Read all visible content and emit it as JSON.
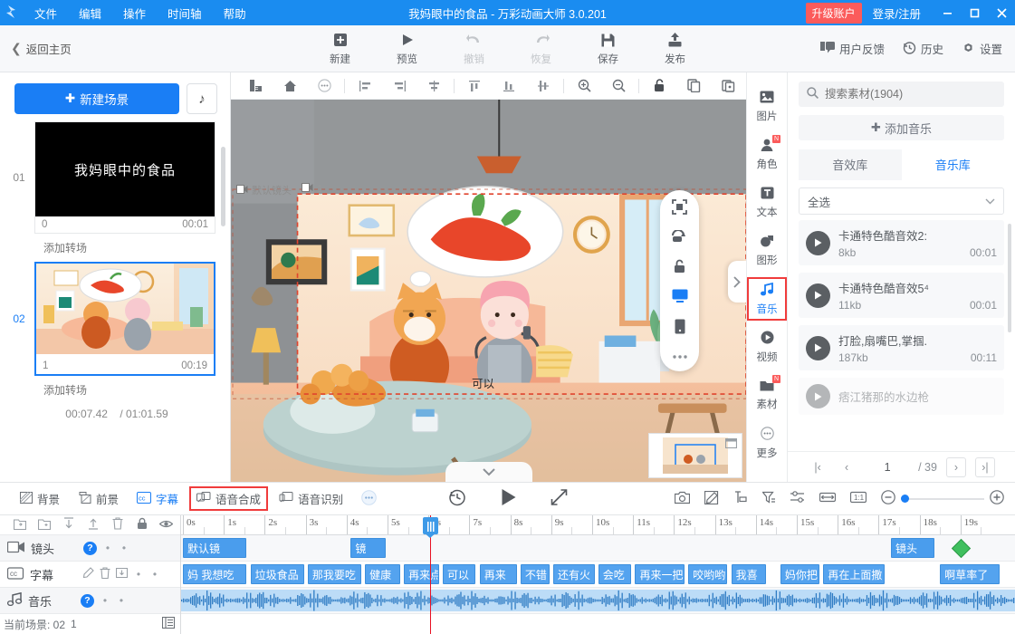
{
  "titlebar": {
    "logo_icon": "app-logo-icon",
    "menus": [
      "文件",
      "编辑",
      "操作",
      "时间轴",
      "帮助"
    ],
    "title": "我妈眼中的食品 - 万彩动画大师 3.0.201",
    "upgrade_label": "升级账户",
    "login_label": "登录/注册",
    "minimize": "—",
    "maximize": "▢",
    "close": "✕",
    "accent": "#1a8cf0",
    "upgrade_color": "#fb5b5b"
  },
  "toolbar": {
    "back_label": "返回主页",
    "buttons": [
      {
        "label": "新建",
        "icon": "plus-square-icon",
        "disabled": false
      },
      {
        "label": "预览",
        "icon": "play-icon",
        "disabled": false
      },
      {
        "label": "撤销",
        "icon": "undo-arrow-icon",
        "disabled": true
      },
      {
        "label": "恢复",
        "icon": "redo-arrow-icon",
        "disabled": true
      },
      {
        "label": "保存",
        "icon": "save-disk-icon",
        "disabled": false
      },
      {
        "label": "发布",
        "icon": "publish-upload-icon",
        "disabled": false
      }
    ],
    "right_items": [
      {
        "label": "用户反馈",
        "icon": "feedback-icon"
      },
      {
        "label": "历史",
        "icon": "history-clock-icon"
      },
      {
        "label": "设置",
        "icon": "gear-icon"
      }
    ]
  },
  "scenes": {
    "new_scene_label": "新建场景",
    "music_btn_icon": "music-note-icon",
    "items": [
      {
        "num": "01",
        "title": "我妈眼中的食品",
        "index": "0",
        "duration": "00:01",
        "selected": false,
        "type": "text"
      },
      {
        "num": "02",
        "title": "",
        "index": "1",
        "duration": "00:19",
        "selected": true,
        "type": "image"
      }
    ],
    "transition_label": "添加转场",
    "current_time": "00:07.42",
    "total_time": "/ 01:01.59"
  },
  "canvas_tools": [
    "ruler-icon",
    "home-icon",
    "more-circle-icon",
    "align-left-icon",
    "align-right-icon",
    "align-center-h-icon",
    "align-top-icon",
    "align-bottom-icon",
    "align-center-v-icon",
    "zoom-in-icon",
    "zoom-out-icon",
    "unlock-icon",
    "copy-icon",
    "paste-icon"
  ],
  "stage": {
    "layer_label": "默认镜头",
    "object_index": "1",
    "speech_text": "可以",
    "float_tools": [
      "select-frame-icon",
      "rotate-icon",
      "unlock-icon",
      "screen-icon",
      "mobile-icon",
      "more-dots-icon"
    ],
    "expand_arrow": "chevron-right-icon",
    "collapse_arrow": "chevron-down-icon",
    "minimap_icon": "minimap-window-icon"
  },
  "rail": [
    {
      "label": "图片",
      "icon": "image-icon",
      "badge": "",
      "selected": false
    },
    {
      "label": "角色",
      "icon": "person-icon",
      "badge": "N",
      "selected": false
    },
    {
      "label": "文本",
      "icon": "text-t-icon",
      "badge": "",
      "selected": false
    },
    {
      "label": "图形",
      "icon": "shapes-icon",
      "badge": "",
      "selected": false
    },
    {
      "label": "音乐",
      "icon": "music-note-icon",
      "badge": "",
      "selected": true
    },
    {
      "label": "视频",
      "icon": "video-play-icon",
      "badge": "",
      "selected": false
    },
    {
      "label": "素材",
      "icon": "folder-icon",
      "badge": "N",
      "selected": false
    },
    {
      "label": "更多",
      "icon": "more-circle-icon",
      "badge": "",
      "selected": false
    }
  ],
  "library": {
    "search_placeholder": "搜索素材(1904)",
    "search_icon": "search-icon",
    "add_music_label": "添加音乐",
    "tabs": [
      {
        "label": "音效库",
        "active": false
      },
      {
        "label": "音乐库",
        "active": true
      }
    ],
    "filter_value": "全选",
    "tracks": [
      {
        "name": "卡通特色酷音效2:",
        "size": "8kb",
        "duration": "00:01"
      },
      {
        "name": "卡通特色酷音效5⁴",
        "size": "11kb",
        "duration": "00:01"
      },
      {
        "name": "打脸,扇嘴巴,掌掴.",
        "size": "187kb",
        "duration": "00:11"
      },
      {
        "name": "痞江猪那的水边枪",
        "size": "",
        "duration": ""
      }
    ],
    "pager": {
      "first": "|‹",
      "prev": "‹",
      "page": "1",
      "total": "/ 39",
      "next": "›",
      "last": "›|"
    }
  },
  "actionbar": {
    "left_items": [
      {
        "label": "背景",
        "icon": "background-icon",
        "state": "normal"
      },
      {
        "label": "前景",
        "icon": "foreground-icon",
        "state": "normal"
      },
      {
        "label": "字幕",
        "icon": "cc-icon",
        "state": "blue"
      },
      {
        "label": "语音合成",
        "icon": "tts-icon",
        "state": "boxed"
      },
      {
        "label": "语音识别",
        "icon": "asr-icon",
        "state": "normal"
      },
      {
        "label": "",
        "icon": "more-circle-icon",
        "state": "normal"
      }
    ],
    "center_items": [
      "replay-icon",
      "play-icon",
      "fullscreen-icon"
    ],
    "right_items": [
      "camera-icon",
      "edit-icon",
      "key-icon",
      "filter-icon",
      "settings-slider-icon",
      "fit-width-icon",
      "one-to-one-icon"
    ],
    "zoom_minus": "−",
    "zoom_plus": "+"
  },
  "timeline": {
    "header_icons": [
      "import-icon",
      "add-folder-icon",
      "move-down-icon",
      "move-up-icon",
      "delete-icon",
      "lock-icon",
      "eye-icon"
    ],
    "rows": [
      {
        "name": "镜头",
        "icon": "camera-track-icon",
        "has_help": true,
        "extra_icons": []
      },
      {
        "name": "字幕",
        "icon": "cc-track-icon",
        "has_help": false,
        "extra_icons": [
          "edit-icon",
          "delete-icon",
          "export-icon"
        ]
      },
      {
        "name": "音乐",
        "icon": "music-track-icon",
        "has_help": true,
        "extra_icons": []
      }
    ],
    "ruler_labels": [
      "0s",
      "1s",
      "2s",
      "3s",
      "4s",
      "5s",
      "6s",
      "7s",
      "8s",
      "9s",
      "10s",
      "11s",
      "12s",
      "13s",
      "14s",
      "15s",
      "16s",
      "17s",
      "18s",
      "19s"
    ],
    "playhead_time": "6s",
    "camera_clips": [
      {
        "label": "默认镜",
        "start": 0.0,
        "end": 1.6
      },
      {
        "label": "镜",
        "start": 4.1,
        "end": 5.0
      },
      {
        "label": "镜头",
        "start": 17.3,
        "end": 18.4
      }
    ],
    "camera_marker": {
      "icon": "keyframe-diamond-icon",
      "pos": 19.0
    },
    "subtitle_clips": [
      {
        "label": "妈 我想吃",
        "start": 0.0,
        "end": 1.6
      },
      {
        "label": "垃圾食品",
        "start": 1.65,
        "end": 3.0
      },
      {
        "label": "那我要吃",
        "start": 3.05,
        "end": 4.4
      },
      {
        "label": "健康",
        "start": 4.45,
        "end": 5.35
      },
      {
        "label": "再来点",
        "start": 5.4,
        "end": 6.3
      },
      {
        "label": "可以",
        "start": 6.35,
        "end": 7.2
      },
      {
        "label": "再来",
        "start": 7.25,
        "end": 8.2
      },
      {
        "label": "不错",
        "start": 8.25,
        "end": 9.0
      },
      {
        "label": "还有火",
        "start": 9.05,
        "end": 10.1
      },
      {
        "label": "会吃",
        "start": 10.15,
        "end": 11.0
      },
      {
        "label": "再来一把",
        "start": 11.05,
        "end": 12.3
      },
      {
        "label": "咬哟哟",
        "start": 12.35,
        "end": 13.35
      },
      {
        "label": "我喜",
        "start": 13.4,
        "end": 14.3
      },
      {
        "label": "妈你把",
        "start": 14.6,
        "end": 15.6
      },
      {
        "label": "再在上面撒",
        "start": 15.65,
        "end": 17.2
      },
      {
        "label": "啊草率了",
        "start": 18.5,
        "end": 20.0
      }
    ],
    "status_text": "当前场景: 02",
    "status_index": "1",
    "status_icon": "list-icon"
  }
}
